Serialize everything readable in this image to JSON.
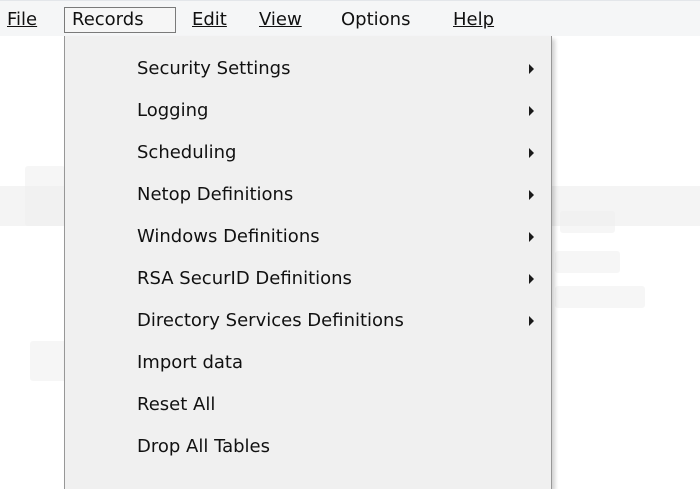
{
  "menubar": {
    "items": [
      {
        "label": "File",
        "accel": "F"
      },
      {
        "label": "Records"
      },
      {
        "label": "Edit",
        "accel": "E"
      },
      {
        "label": "View",
        "accel": "V"
      },
      {
        "label": "Options"
      },
      {
        "label": "Help",
        "accel": "H"
      }
    ],
    "open_menu": "Records"
  },
  "records_menu": {
    "items": [
      {
        "label": "Security Settings",
        "submenu": true
      },
      {
        "label": "Logging",
        "submenu": true
      },
      {
        "label": "Scheduling",
        "submenu": true
      },
      {
        "label": "Netop Definitions",
        "submenu": true
      },
      {
        "label": "Windows Definitions",
        "submenu": true
      },
      {
        "label": "RSA SecurID Definitions",
        "submenu": true
      },
      {
        "label": "Directory Services Definitions",
        "submenu": true
      },
      {
        "label": "Import data",
        "submenu": false
      },
      {
        "label": "Reset All",
        "submenu": false
      },
      {
        "label": "Drop All Tables",
        "submenu": false
      }
    ]
  },
  "icons": {
    "submenu_arrow": "chevron-right-icon"
  },
  "colors": {
    "menubar_bg": "#f5f6f7",
    "menu_bg": "#f0f0f0",
    "menu_border": "#979797",
    "text": "#111111"
  }
}
